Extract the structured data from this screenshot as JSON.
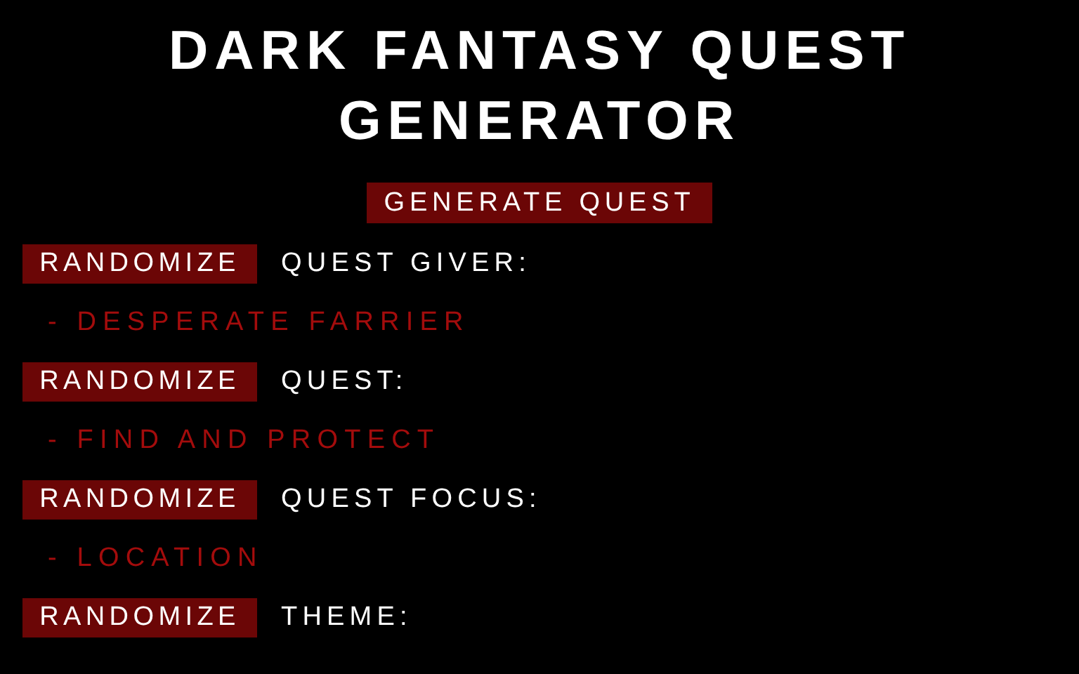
{
  "title": "DARK FANTASY QUEST GENERATOR",
  "generate_button": "GENERATE QUEST",
  "fields": [
    {
      "button": "RANDOMIZE",
      "label": "QUEST GIVER:",
      "value": "- DESPERATE FARRIER"
    },
    {
      "button": "RANDOMIZE",
      "label": "QUEST:",
      "value": "- FIND AND PROTECT"
    },
    {
      "button": "RANDOMIZE",
      "label": "QUEST FOCUS:",
      "value": "- LOCATION"
    },
    {
      "button": "RANDOMIZE",
      "label": "THEME:"
    }
  ]
}
